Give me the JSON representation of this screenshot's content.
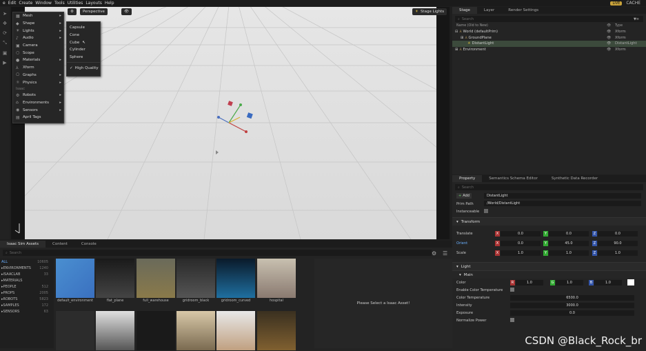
{
  "menubar": {
    "items": [
      "e",
      "Edit",
      "Create",
      "Window",
      "Tools",
      "Utilities",
      "Layouts",
      "Help"
    ],
    "live": "LIVE",
    "cache": "CACHE"
  },
  "viewport": {
    "perspective": "Perspective",
    "stage_lights": "Stage Lights"
  },
  "create_menu": {
    "items": [
      {
        "label": "Mesh",
        "icon": "mesh-icon",
        "submenu": true
      },
      {
        "label": "Shape",
        "icon": "shape-icon",
        "submenu": true
      },
      {
        "label": "Lights",
        "icon": "light-icon",
        "submenu": true
      },
      {
        "label": "Audio",
        "icon": "audio-icon",
        "submenu": true
      },
      {
        "label": "Camera",
        "icon": "camera-icon",
        "submenu": false
      },
      {
        "label": "Scope",
        "icon": "scope-icon",
        "submenu": false
      },
      {
        "label": "Materials",
        "icon": "materials-icon",
        "submenu": true
      },
      {
        "label": "Xform",
        "icon": "xform-icon",
        "submenu": false
      },
      {
        "label": "Graphs",
        "icon": "graph-icon",
        "submenu": true
      },
      {
        "label": "Physics",
        "icon": "physics-icon",
        "submenu": true
      }
    ],
    "section": "Isaac",
    "isaac_items": [
      {
        "label": "Robots",
        "icon": "robot-icon",
        "submenu": true
      },
      {
        "label": "Environments",
        "icon": "environment-icon",
        "submenu": true
      },
      {
        "label": "Sensors",
        "icon": "sensor-icon",
        "submenu": true
      },
      {
        "label": "April Tags",
        "icon": "tag-icon",
        "submenu": false
      }
    ]
  },
  "shape_menu": {
    "items": [
      "Capsule",
      "Cone",
      "Cube",
      "Cylinder",
      "Sphere"
    ],
    "high_quality": "High Quality"
  },
  "stage": {
    "tabs": [
      "Stage",
      "Layer",
      "Render Settings"
    ],
    "search_placeholder": "Search",
    "col_name": "Name (Old to New)",
    "col_type": "Type",
    "rows": [
      {
        "name": "World (defaultPrim)",
        "type": "Xform"
      },
      {
        "name": "GroundPlane",
        "type": "Xform"
      },
      {
        "name": "DistantLight",
        "type": "DistantLight"
      },
      {
        "name": "Environment",
        "type": "Xform"
      }
    ]
  },
  "property": {
    "tabs": [
      "Property",
      "Semantics Schema Editor",
      "Synthetic Data Recorder"
    ],
    "search_placeholder": "Search",
    "add_label": "Add",
    "add_value": "DistantLight",
    "prim_path_label": "Prim Path",
    "prim_path": "/World/DistantLight",
    "instanceable_label": "Instanceable",
    "transform_header": "Transform",
    "translate": {
      "label": "Translate",
      "x": "0.0",
      "y": "0.0",
      "z": "0.0"
    },
    "orient": {
      "label": "Orient",
      "x": "0.0",
      "y": "45.0",
      "z": "90.0"
    },
    "scale": {
      "label": "Scale",
      "x": "1.0",
      "y": "1.0",
      "z": "1.0"
    },
    "light_header": "Light",
    "main_header": "Main",
    "color": {
      "label": "Color",
      "r": "1.0",
      "g": "1.0",
      "b": "1.0"
    },
    "enable_color_temp": "Enable Color Temperature",
    "color_temp": {
      "label": "Color Temperature",
      "value": "6500.0"
    },
    "intensity": {
      "label": "Intensity",
      "value": "3000.0"
    },
    "exposure": {
      "label": "Exposure",
      "value": "0.0"
    },
    "normalize": "Normalize Power"
  },
  "assets": {
    "tabs": [
      "Isaac Sim Assets",
      "Content",
      "Console"
    ],
    "search_placeholder": "Search",
    "categories": [
      {
        "name": "ALL",
        "count": "10605"
      },
      {
        "name": "ENVIRONMENTS",
        "count": "1240"
      },
      {
        "name": "ISAACLAB",
        "count": "33"
      },
      {
        "name": "MATERIALS",
        "count": ""
      },
      {
        "name": "PEOPLE",
        "count": "512"
      },
      {
        "name": "PROPS",
        "count": "2005"
      },
      {
        "name": "ROBOTS",
        "count": "5823"
      },
      {
        "name": "SAMPLES",
        "count": "172"
      },
      {
        "name": "SENSORS",
        "count": "63"
      }
    ],
    "thumbs": [
      "default_environment",
      "flat_plane",
      "full_warehouse",
      "gridroom_black",
      "gridroom_curved",
      "hospital"
    ],
    "detail_text": "Please Select a Isaac Asset!"
  },
  "watermark": "CSDN @Black_Rock_br"
}
